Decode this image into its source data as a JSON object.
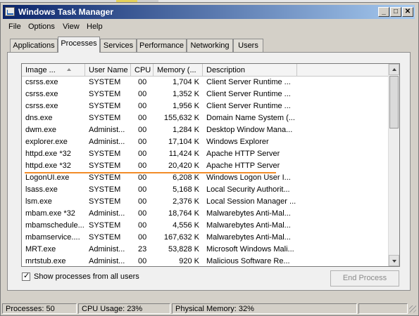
{
  "window": {
    "title": "Windows Task Manager"
  },
  "title_buttons": {
    "minimize": "_",
    "maximize": "□",
    "close": "✕"
  },
  "menu": [
    "File",
    "Options",
    "View",
    "Help"
  ],
  "tabs": [
    {
      "label": "Applications",
      "active": false
    },
    {
      "label": "Processes",
      "active": true
    },
    {
      "label": "Services",
      "active": false
    },
    {
      "label": "Performance",
      "active": false
    },
    {
      "label": "Networking",
      "active": false
    },
    {
      "label": "Users",
      "active": false
    }
  ],
  "columns": [
    "Image ...",
    "User Name",
    "CPU",
    "Memory (...",
    "Description"
  ],
  "rows": [
    [
      "csrss.exe",
      "SYSTEM",
      "00",
      "1,704 K",
      "Client Server Runtime ..."
    ],
    [
      "csrss.exe",
      "SYSTEM",
      "00",
      "1,352 K",
      "Client Server Runtime ..."
    ],
    [
      "csrss.exe",
      "SYSTEM",
      "00",
      "1,956 K",
      "Client Server Runtime ..."
    ],
    [
      "dns.exe",
      "SYSTEM",
      "00",
      "155,632 K",
      "Domain Name System (..."
    ],
    [
      "dwm.exe",
      "Administ...",
      "00",
      "1,284 K",
      "Desktop Window Mana..."
    ],
    [
      "explorer.exe",
      "Administ...",
      "00",
      "17,104 K",
      "Windows Explorer"
    ],
    [
      "httpd.exe *32",
      "SYSTEM",
      "00",
      "11,424 K",
      "Apache HTTP Server"
    ],
    [
      "httpd.exe *32",
      "SYSTEM",
      "00",
      "20,420 K",
      "Apache HTTP Server"
    ],
    [
      "LogonUI.exe",
      "SYSTEM",
      "00",
      "6,208 K",
      "Windows Logon User I..."
    ],
    [
      "lsass.exe",
      "SYSTEM",
      "00",
      "5,168 K",
      "Local Security Authorit..."
    ],
    [
      "lsm.exe",
      "SYSTEM",
      "00",
      "2,376 K",
      "Local Session Manager ..."
    ],
    [
      "mbam.exe *32",
      "Administ...",
      "00",
      "18,764 K",
      "Malwarebytes Anti-Mal..."
    ],
    [
      "mbamschedule...",
      "SYSTEM",
      "00",
      "4,556 K",
      "Malwarebytes Anti-Mal..."
    ],
    [
      "mbamservice....",
      "SYSTEM",
      "00",
      "167,632 K",
      "Malwarebytes Anti-Mal..."
    ],
    [
      "MRT.exe",
      "Administ...",
      "23",
      "53,828 K",
      "Microsoft Windows Mali..."
    ],
    [
      "mrtstub.exe",
      "Administ...",
      "00",
      "920 K",
      "Malicious Software Re..."
    ]
  ],
  "show_all_users": {
    "label": "Show processes from all users",
    "checked": true
  },
  "end_process_label": "End Process",
  "status": {
    "processes": "Processes: 50",
    "cpu": "CPU Usage: 23%",
    "memory": "Physical Memory: 32%"
  },
  "colors": {
    "titlebar_start": "#0a246a",
    "titlebar_end": "#a6caf0",
    "highlight_line": "#f28c28"
  }
}
